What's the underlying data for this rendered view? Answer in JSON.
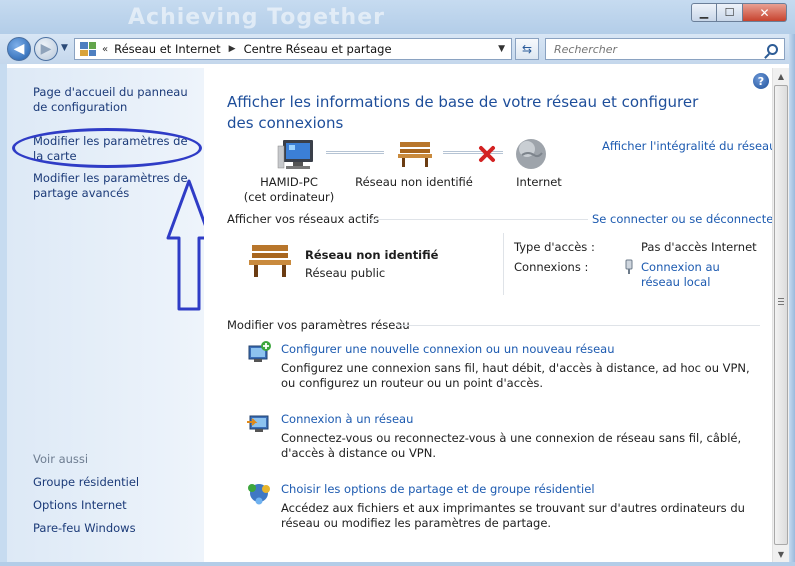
{
  "window": {
    "ghost_title": "Achieving Together",
    "min_glyph": "▁",
    "max_glyph": "☐",
    "close_glyph": "✕"
  },
  "nav": {
    "crumb_sep": "«",
    "crumbs": [
      "Réseau et Internet",
      "Centre Réseau et partage"
    ],
    "crumb_arrow": "▶",
    "search_placeholder": "Rechercher"
  },
  "sidebar": {
    "links": [
      "Page d'accueil du panneau de configuration",
      "Modifier les paramètres de la carte",
      "Modifier les paramètres de partage avancés"
    ],
    "see_also_title": "Voir aussi",
    "see_also": [
      "Groupe résidentiel",
      "Options Internet",
      "Pare-feu Windows"
    ]
  },
  "main": {
    "title": "Afficher les informations de base de votre réseau et configurer des connexions",
    "view_full_map": "Afficher l'intégralité du réseau",
    "map": {
      "computer_name": "HAMID-PC",
      "computer_sub": "(cet ordinateur)",
      "network_name": "Réseau non identifié",
      "internet": "Internet"
    },
    "active_networks": {
      "heading": "Afficher vos réseaux actifs",
      "connect_link": "Se connecter ou se déconnecter",
      "network_name": "Réseau non identifié",
      "network_type": "Réseau public",
      "access_type_label": "Type d'accès :",
      "access_type_value": "Pas d'accès Internet",
      "connections_label": "Connexions :",
      "connection_value": "Connexion au réseau local"
    },
    "change_settings": {
      "heading": "Modifier vos paramètres réseau",
      "tasks": [
        {
          "title": "Configurer une nouvelle connexion ou un nouveau réseau",
          "desc": "Configurez une connexion sans fil, haut débit, d'accès à distance, ad hoc ou VPN, ou configurez un routeur ou un point d'accès."
        },
        {
          "title": "Connexion à un réseau",
          "desc": "Connectez-vous ou reconnectez-vous à une connexion de réseau sans fil, câblé, d'accès à distance ou VPN."
        },
        {
          "title": "Choisir les options de partage et de groupe résidentiel",
          "desc": "Accédez aux fichiers et aux imprimantes se trouvant sur d'autres ordinateurs du réseau ou modifiez les paramètres de partage."
        }
      ]
    }
  },
  "colors": {
    "link": "#1c5ab0",
    "title": "#1e4e9a",
    "annotation": "#2f3cc6",
    "error_x": "#d32222"
  }
}
